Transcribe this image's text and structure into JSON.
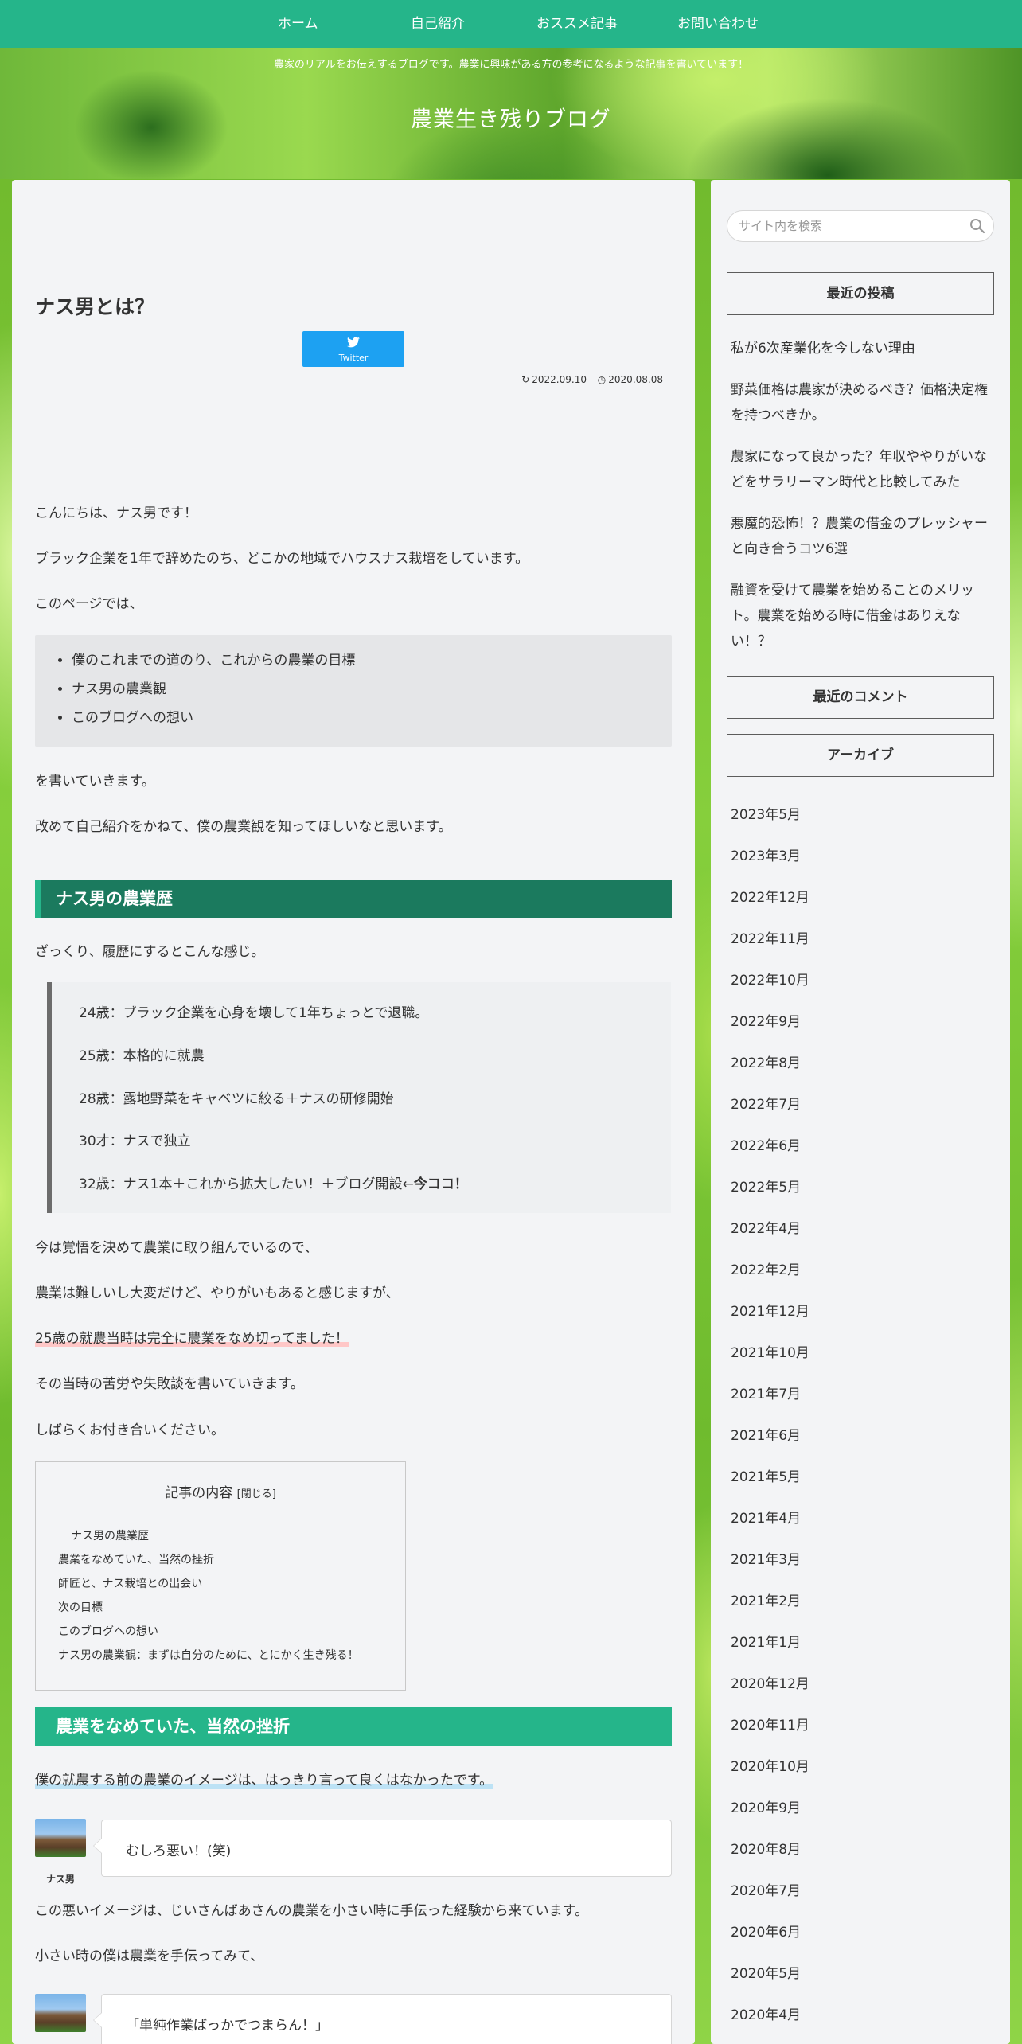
{
  "nav": {
    "items": [
      {
        "label": "ホーム"
      },
      {
        "label": "自己紹介"
      },
      {
        "label": "おススメ記事"
      },
      {
        "label": "お問い合わせ"
      }
    ]
  },
  "header": {
    "tagline": "農家のリアルをお伝えするブログです。農業に興味がある方の参考になるような記事を書いています！",
    "site_title": "農業生き残りブログ"
  },
  "article": {
    "title": "ナス男とは？",
    "twitter_label": "Twitter",
    "updated_date": "2022.09.10",
    "published_date": "2020.08.08",
    "intro": [
      "こんにちは、ナス男です！",
      "ブラック企業を1年で辞めたのち、どこかの地域でハウスナス栽培をしています。",
      "このページでは、"
    ],
    "topics": [
      "僕のこれまでの道のり、これからの農業の目標",
      "ナス男の農業観",
      "このブログへの想い"
    ],
    "after_topics": [
      "を書いていきます。",
      "改めて自己紹介をかねて、僕の農業観を知ってほしいなと思います。"
    ],
    "h2_history": "ナス男の農業歴",
    "history_lead": "ざっくり、履歴にするとこんな感じ。",
    "history": [
      "24歳：ブラック企業を心身を壊して1年ちょっとで退職。",
      "25歳：本格的に就農",
      "28歳：露地野菜をキャベツに絞る＋ナスの研修開始",
      "30才：ナスで独立"
    ],
    "history_last": "32歳：ナス1本＋これから拡大したい！＋ブログ開設←",
    "history_last_bold": "今ココ！",
    "para2_1": "今は覚悟を決めて農業に取り組んでいるので、",
    "para2_2": "農業は難しいし大変だけど、やりがいもあると感じますが、",
    "para2_3": "25歳の就農当時は完全に農業をなめ切ってました！",
    "para2_4": "その当時の苦労や失敗談を書いていきます。",
    "para2_5": "しばらくお付き合いください。",
    "toc": {
      "title": "記事の内容",
      "toggle": "[閉じる]",
      "items": [
        "ナス男の農業歴",
        "農業をなめていた、当然の挫折",
        "師匠と、ナス栽培との出会い",
        "次の目標",
        "このブログへの想い",
        "ナス男の農業観：まずは自分のために、とにかく生き残る！"
      ]
    },
    "h2_failure": "農業をなめていた、当然の挫折",
    "failure_lead": "僕の就農する前の農業のイメージは、はっきり言って良くはなかったです。",
    "speaker_name": "ナス男",
    "balloon1": "むしろ悪い！(笑)",
    "para3_1": "この悪いイメージは、じいさんばあさんの農業を小さい時に手伝った経験から来ています。",
    "para3_2": "小さい時の僕は農業を手伝ってみて、",
    "balloon2": "「単純作業ばっかでつまらん！」"
  },
  "sidebar": {
    "search_placeholder": "サイト内を検索",
    "recent_posts_title": "最近の投稿",
    "recent_posts": [
      "私が6次産業化を今しない理由",
      "野菜価格は農家が決めるべき？価格決定権を持つべきか。",
      "農家になって良かった？年収ややりがいなどをサラリーマン時代と比較してみた",
      "悪魔的恐怖！？農業の借金のプレッシャーと向き合うコツ6選",
      "融資を受けて農業を始めることのメリット。農業を始める時に借金はありえない！？"
    ],
    "recent_comments_title": "最近のコメント",
    "archives_title": "アーカイブ",
    "archives": [
      "2023年5月",
      "2023年3月",
      "2022年12月",
      "2022年11月",
      "2022年10月",
      "2022年9月",
      "2022年8月",
      "2022年7月",
      "2022年6月",
      "2022年5月",
      "2022年4月",
      "2022年2月",
      "2021年12月",
      "2021年10月",
      "2021年7月",
      "2021年6月",
      "2021年5月",
      "2021年4月",
      "2021年3月",
      "2021年2月",
      "2021年1月",
      "2020年12月",
      "2020年11月",
      "2020年10月",
      "2020年9月",
      "2020年8月",
      "2020年7月",
      "2020年6月",
      "2020年5月",
      "2020年4月"
    ]
  },
  "colors": {
    "accent": "#25b58a",
    "accent_dark": "#1b7a5e",
    "twitter": "#1da1f2"
  }
}
